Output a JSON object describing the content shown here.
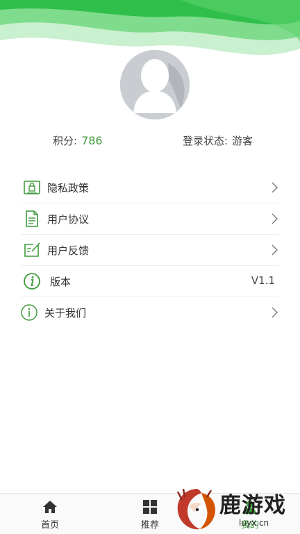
{
  "profile": {
    "points_label": "积分:",
    "points_value": "786",
    "login_label": "登录状态:",
    "login_value": "游客"
  },
  "menu": {
    "items": [
      {
        "label": "隐私政策",
        "icon": "privacy-lock-icon"
      },
      {
        "label": "用户协议",
        "icon": "document-icon"
      },
      {
        "label": "用户反馈",
        "icon": "feedback-edit-icon"
      },
      {
        "label": "版本",
        "icon": "info-icon",
        "value": "V1.1"
      },
      {
        "label": "关于我们",
        "icon": "info-circle-icon"
      }
    ]
  },
  "bottom_nav": {
    "items": [
      {
        "label": "首页",
        "icon": "home-icon"
      },
      {
        "label": "推荐",
        "icon": "grid-icon"
      },
      {
        "label": "我的",
        "icon": "user-icon"
      }
    ]
  },
  "watermark": {
    "text": "鹿游戏",
    "url": "luyx.cn"
  },
  "colors": {
    "accent_green": "#3d9a3a",
    "header_green": "#2fbf4a"
  }
}
